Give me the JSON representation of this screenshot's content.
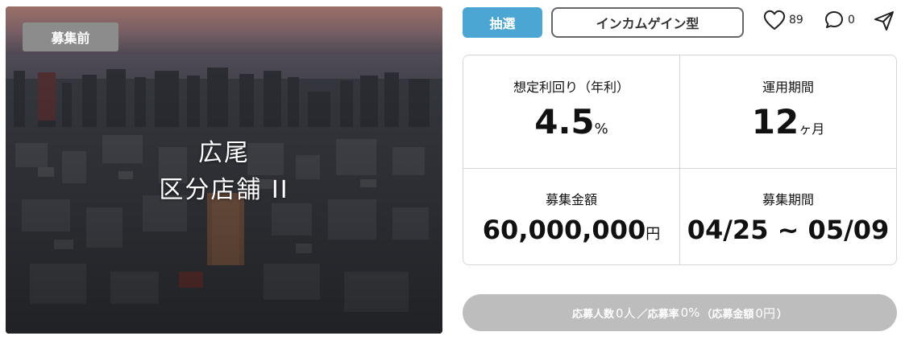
{
  "hero": {
    "status_badge": "募集前",
    "title_line1": "広尾",
    "title_line2": "区分店舗 II"
  },
  "tags": {
    "method": "抽選",
    "type": "インカムゲイン型"
  },
  "actions": {
    "likes": "89",
    "comments": "0",
    "like_icon": "heart-icon",
    "comment_icon": "speech-bubble-icon",
    "share_icon": "paper-plane-icon"
  },
  "info": {
    "yield_label": "想定利回り（年利）",
    "yield_value": "4.5",
    "yield_unit": "%",
    "period_label": "運用期間",
    "period_value": "12",
    "period_unit": "ヶ月",
    "amount_label": "募集金額",
    "amount_value": "60,000,000",
    "amount_unit": "円",
    "recruit_label": "募集期間",
    "recruit_value": "04/25 ~ 05/09"
  },
  "status_bar": {
    "applicants_label": "応募人数",
    "applicants_value": "0人",
    "sep": "／",
    "rate_label": "応募率",
    "rate_value": "0%",
    "amount_open": "（応募金額",
    "amount_value": "0円",
    "amount_close": "）"
  },
  "colors": {
    "lottery_tag": "#4ba6d3",
    "status_bar": "#bdbdbd",
    "badge": "#8c8c8c"
  }
}
